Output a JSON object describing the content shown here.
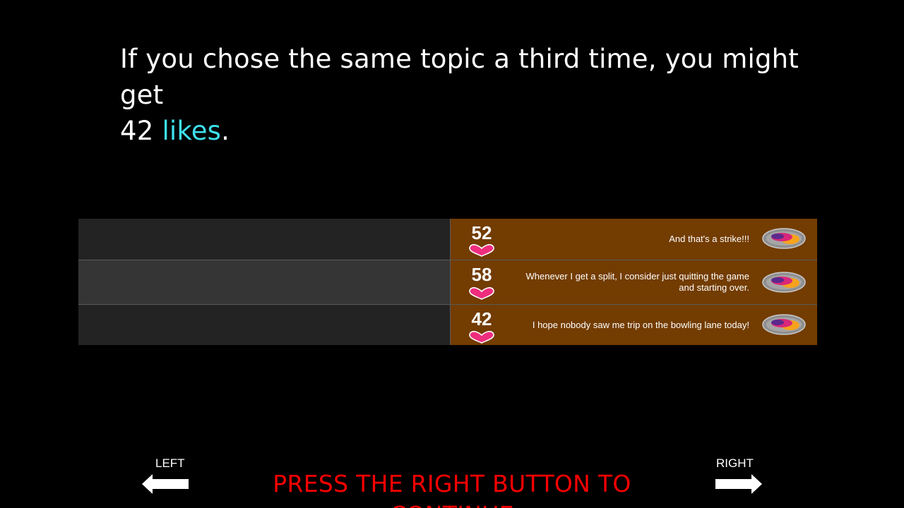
{
  "intro": {
    "line1": "If you chose the same topic a third time, you might get",
    "number": "42",
    "highlight_word": "likes",
    "end_punctuation": ".",
    "accent_color": "#3ee0ea"
  },
  "feed": {
    "post_color": "#733c00",
    "heart_color": "#ee2d7d",
    "rows": [
      {
        "likes": "52",
        "text": "And that's a strike!!!",
        "icon": "bowling-topic-icon"
      },
      {
        "likes": "58",
        "text": "Whenever I get a split, I consider just quitting the game and starting over.",
        "icon": "bowling-topic-icon"
      },
      {
        "likes": "42",
        "text": "I hope nobody saw me trip on the bowling lane today!",
        "icon": "bowling-topic-icon"
      }
    ]
  },
  "footer": {
    "left_label": "LEFT",
    "right_label": "RIGHT",
    "left_icon": "arrow-left-icon",
    "right_icon": "arrow-right-icon",
    "instruction": "PRESS THE RIGHT BUTTON TO CONTINUE",
    "instruction_color": "#ff0000"
  }
}
